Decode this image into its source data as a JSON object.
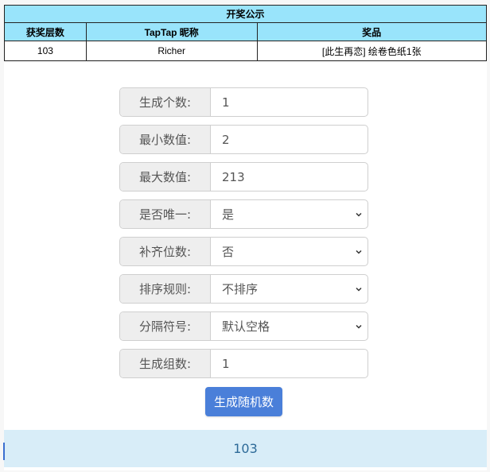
{
  "announcement": {
    "title": "开奖公示",
    "headers": [
      "获奖层数",
      "TapTap 昵称",
      "奖品"
    ],
    "rows": [
      [
        "103",
        "Richer",
        "[此生再恋] 绘卷色纸1张"
      ]
    ]
  },
  "form": {
    "count": {
      "label": "生成个数:",
      "value": "1"
    },
    "min": {
      "label": "最小数值:",
      "value": "2"
    },
    "max": {
      "label": "最大数值:",
      "value": "213"
    },
    "unique": {
      "label": "是否唯一:",
      "value": "是"
    },
    "pad": {
      "label": "补齐位数:",
      "value": "否"
    },
    "sort": {
      "label": "排序规则:",
      "value": "不排序"
    },
    "separator": {
      "label": "分隔符号:",
      "value": "默认空格"
    },
    "groups": {
      "label": "生成组数:",
      "value": "1"
    }
  },
  "generate_button": "生成随机数",
  "result": "103",
  "colors": {
    "header_bg": "#99e4fb",
    "button_bg": "#4a7fd9",
    "result_bg": "#d8edf8",
    "result_text": "#2d6a98"
  }
}
